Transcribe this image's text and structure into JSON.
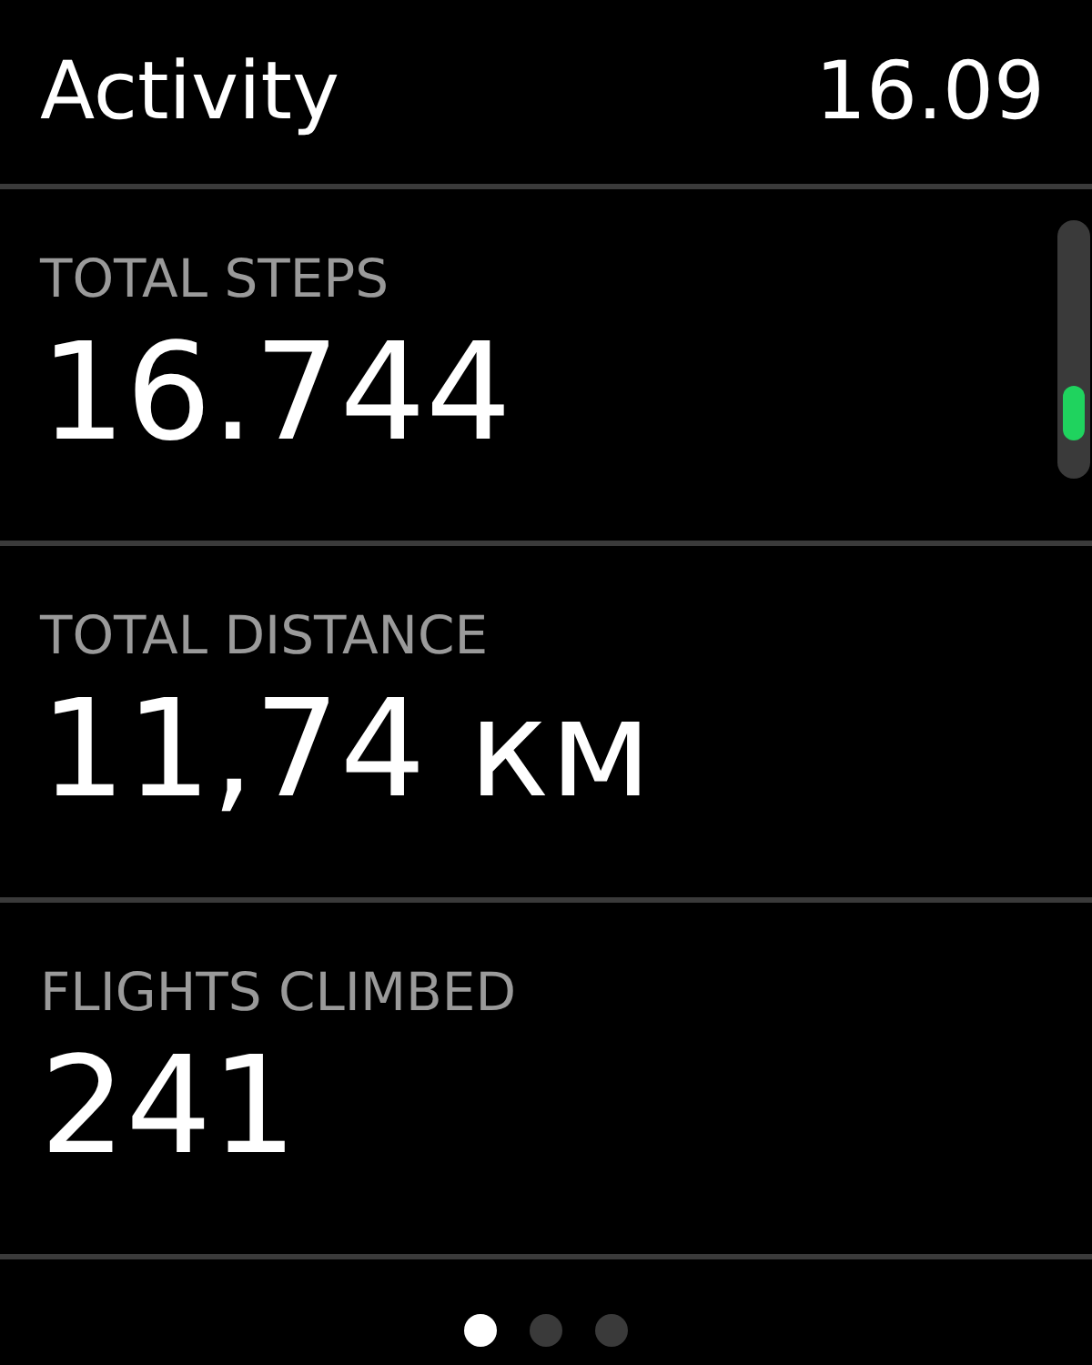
{
  "header": {
    "title": "Activity",
    "time": "16.09"
  },
  "metrics": [
    {
      "label": "TOTAL STEPS",
      "value": "16.744"
    },
    {
      "label": "TOTAL DISTANCE",
      "value": "11,74 км"
    },
    {
      "label": "FLIGHTS CLIMBED",
      "value": "241"
    }
  ],
  "page_dots": [
    {
      "selected": true
    },
    {
      "selected": false
    },
    {
      "selected": false
    }
  ]
}
